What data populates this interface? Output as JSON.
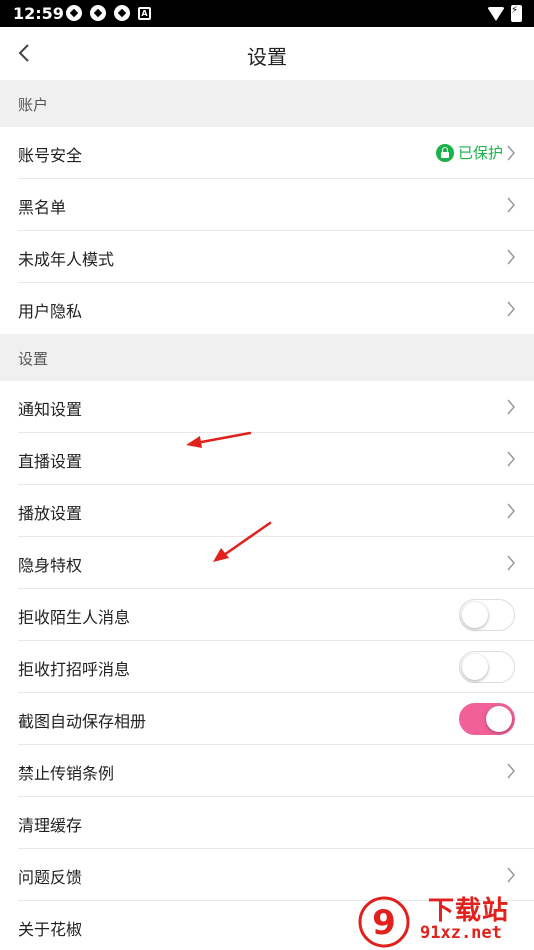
{
  "status_bar": {
    "time": "12:59",
    "badge": "A"
  },
  "header": {
    "title": "设置"
  },
  "sections": {
    "account": "账户",
    "settings": "设置"
  },
  "rows": {
    "account_security": "账号安全",
    "account_security_status": "已保护",
    "blacklist": "黑名单",
    "minor_mode": "未成年人模式",
    "user_privacy": "用户隐私",
    "notification_settings": "通知设置",
    "live_settings": "直播设置",
    "playback_settings": "播放设置",
    "stealth_privilege": "隐身特权",
    "reject_stranger_messages": "拒收陌生人消息",
    "reject_greeting_messages": "拒收打招呼消息",
    "auto_save_screenshots": "截图自动保存相册",
    "anti_pyramid_rules": "禁止传销条例",
    "clear_cache": "清理缓存",
    "feedback": "问题反馈",
    "about": "关于花椒"
  },
  "toggles": {
    "reject_stranger_messages": false,
    "reject_greeting_messages": false,
    "auto_save_screenshots": true
  },
  "colors": {
    "protect_green": "#19b34a",
    "toggle_on": "#f2609a",
    "annotation_arrow": "#e0211d"
  },
  "watermark": {
    "text": "下载站",
    "url": "91xz.net",
    "logo": "9"
  }
}
